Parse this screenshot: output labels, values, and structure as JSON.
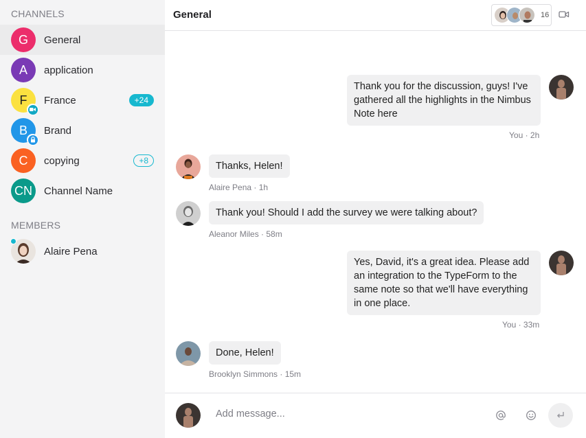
{
  "sidebar": {
    "channels_title": "CHANNELS",
    "channels": [
      {
        "initials": "G",
        "name": "General",
        "color": "#ec2d6b",
        "active": true
      },
      {
        "initials": "A",
        "name": "application",
        "color": "#7a3ab5"
      },
      {
        "initials": "F",
        "name": "France",
        "color": "#fbe140",
        "text_color": "#222",
        "sub_icon": "video-icon",
        "badge": "+24",
        "badge_style": "filled"
      },
      {
        "initials": "B",
        "name": "Brand",
        "color": "#2196e8",
        "sub_icon": "lock-icon"
      },
      {
        "initials": "C",
        "name": "copying",
        "color": "#fa6122",
        "badge": "+8",
        "badge_style": "outline"
      },
      {
        "initials": "CN",
        "name": "Channel Name",
        "color": "#0a9a8a"
      }
    ],
    "members_title": "MEMBERS",
    "members": [
      {
        "name": "Alaire Pena",
        "online": true
      }
    ]
  },
  "header": {
    "title": "General",
    "participant_count": "16"
  },
  "messages": [
    {
      "author": "You",
      "own": true,
      "text": "Thank you for the discussion, guys! I've gathered all the highlights in the Nimbus Note here",
      "meta": "You · 2h"
    },
    {
      "author": "Alaire Pena",
      "own": false,
      "text": "Thanks, Helen!",
      "meta": "Alaire Pena · 1h"
    },
    {
      "author": "Aleanor Miles",
      "own": false,
      "text": "Thank you! Should I add the survey we were talking about?",
      "meta": "Aleanor Miles · 58m"
    },
    {
      "author": "You",
      "own": true,
      "text": "Yes, David, it's a great idea. Please add an integration to the TypeForm to the same note so that we'll have everything in one place.",
      "meta": "You · 33m"
    },
    {
      "author": "Brooklyn Simmons",
      "own": false,
      "text": "Done, Helen!",
      "meta": "Brooklyn Simmons · 15m"
    }
  ],
  "composer": {
    "placeholder": "Add message..."
  },
  "colors": {
    "accent": "#17b8cf",
    "sidebar_bg": "#f4f4f5",
    "bubble_bg": "#f0f0f1"
  }
}
